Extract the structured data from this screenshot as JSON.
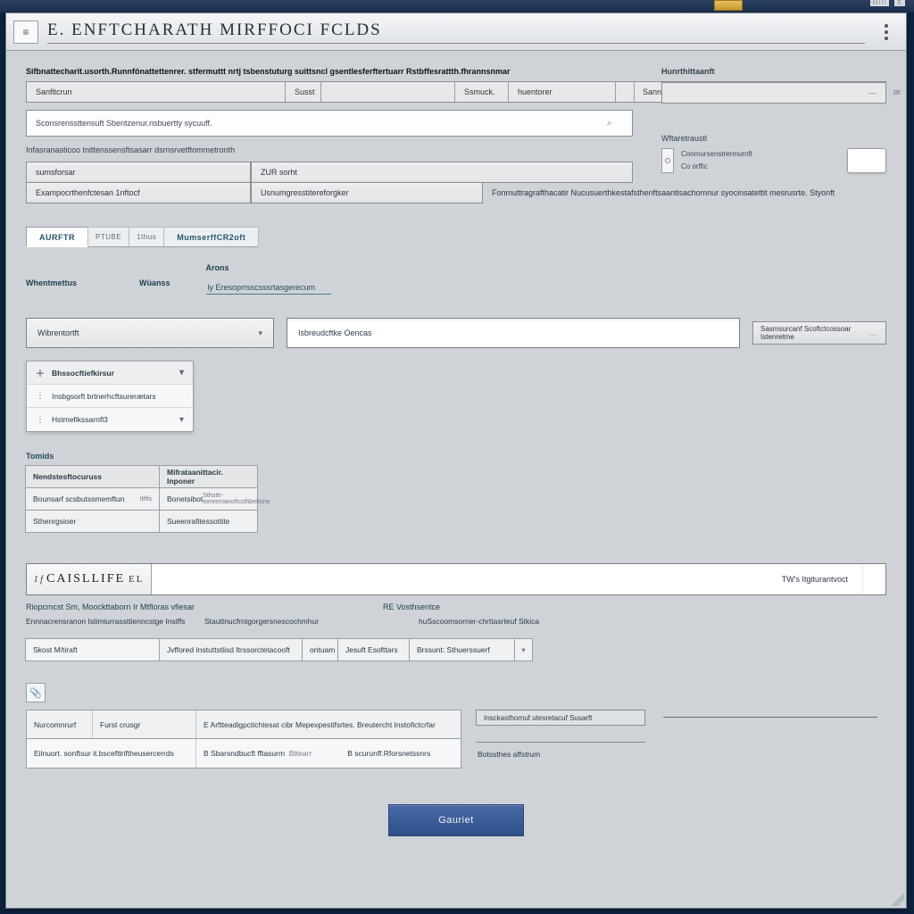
{
  "chrome": {
    "top_right_a": "MIII",
    "top_right_b": "E"
  },
  "titlebar": {
    "home_glyph": "≡",
    "title": "E. ENFTCHARATH MIRFFOCI FCLDS"
  },
  "sectionA": {
    "breadcrumb": "Sifbnattecharit.usorth.Runnfönattettenrer. stfermuttt nrtj tsbenstuturg suittsncl gsentlesferftertuarr Rstbffesrattth.fhrannsnmar",
    "headers": {
      "c1": "Sanfitcrun",
      "c2": "Susst",
      "c3": "Ssmuck.",
      "c4": "huentorer",
      "c5": "Sannsosn",
      "c6": "or"
    },
    "search_value": "Sconsrenssttensuft Sbentzenur.nsbuertty sycuuff.",
    "hint": "Infasranasticoo tnittenssensftsasarr dsrnsrvetftommetronth",
    "rowB": {
      "c1": "sumsforsar",
      "c2": "ZUR sorht"
    },
    "rowC": {
      "c1": "Exampocrthenfctesan 1nftocf",
      "c2": "Usnumgresstitereforgker",
      "c3": "Fonmuttragrafthacatir Nucusuerthkestafsthenftsaantisachomnur syocinsatettit mesrusrte. Styonft"
    }
  },
  "rightcol": {
    "label": "Hunrthittaanft",
    "row_value": "",
    "subtitle": "Wftaretraustl",
    "opt1": "Conmursenstrermurnft",
    "opt2": "Co orffic"
  },
  "tabs": {
    "t1": "AURFTR",
    "t2": "PTUBE",
    "t3": "1thus",
    "t4": "MumserffCR2oft"
  },
  "form": {
    "l1": "Whentmettus",
    "l2": "Wüanss",
    "l3": "Arons",
    "v3": "ly Eresoprrsscsssrtasgerecum"
  },
  "selrow": {
    "select_label": "Wibrentortft",
    "textbox_value": "Isbreudcftke Oencas",
    "sidebtn_label": "Sasmsurcanf Scoftctcossoar Istenretme"
  },
  "tree": {
    "n1": "Bhssocftiefkirsur",
    "n2": "Insbgsorft brtnerhcftsurerætars",
    "n3": "Hstmefikssarnfl3"
  },
  "tomids": {
    "label": "Tomids",
    "h1": "Nendstesftocuruss",
    "h2": "Mifrataanittacir. Inponer",
    "r1a": "Bounsarf scsbutssmemftun",
    "r1b": "Itftfs",
    "r1c": "Bonetsibot",
    "r1d": "Sthottr-tomremanoftcsthbettone",
    "r2a": "Sthenrgsioer",
    "r2b": "Sueenrafitessottite"
  },
  "cas": {
    "brand_pre": "1f",
    "brand_main": "CAISLLIFE",
    "brand_post": "EL",
    "right_text": "TW's Itgiturantvoct",
    "m1_left": "Riopcmcst Sm, Moockttaborn Ir Mtfloras vfiesar",
    "m1_right": "RE Vosthsentce",
    "m2_a": "Ennnacrensranon Istimiurrassttienncstge Insiffs",
    "m2_b": "Stauttnucfrntgorgersnescochmhur",
    "m2_c": "huSscoomsorner-chrttasrteuf Stkica",
    "bar": {
      "b1": "Skost M/tiraft",
      "b2": "Jvffored Instuttstlisd Itrssorctetacooft",
      "b3": "ontuam",
      "b4": "Jesuft Esofttars",
      "b5": "Brssunt: Sthuerssuerf"
    }
  },
  "bottom": {
    "left": {
      "h1": "Nurcomnrurf",
      "h2": "Furst crusgr",
      "h3": "E Arftteadigpctichtesat cibr Mepexpestifsrtes. Breutercht Instofictcrfar",
      "r2a": "Eilnuort. sonftsur it.bscefttriftheusercerrds",
      "r2b1": "B Sbarsndbucft fftasurm",
      "r2b1b": "Bttearr",
      "r2b2": "B scurunff.Rforsnetssnrs"
    },
    "mid": {
      "head": "Insckasthornuf utesretacuf Susarft",
      "line": "Botssthes affstrum"
    }
  },
  "submit": "Gauriet"
}
